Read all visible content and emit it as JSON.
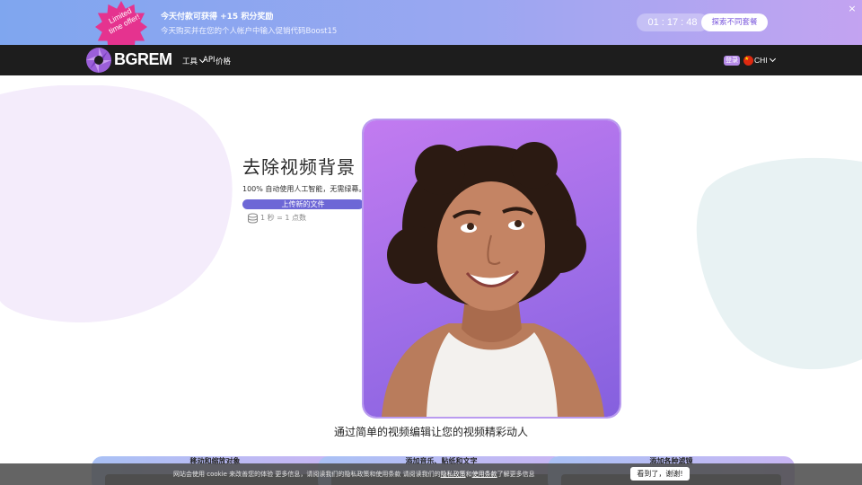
{
  "promo": {
    "badge_line1": "Limited",
    "badge_line2": "time offer!",
    "title": "今天付款可获得 +15 积分奖励",
    "subtitle": "今天购买并在您的个人帐户中输入促销代码Boost15",
    "timer": "01 : 17 : 48",
    "explore_label": "探索不同套餐",
    "close_icon": "×",
    "colors": {
      "gradient_start": "#7fa6ef",
      "gradient_end": "#c3a3f1",
      "badge": "#e5338f"
    }
  },
  "nav": {
    "logo_text": "BGREM",
    "tools_label": "工具",
    "api_label": "API",
    "pricing_label": "价格",
    "login_label": "登录",
    "language": "CHI",
    "icons": [
      "aperture-logo-icon",
      "chevron-down-icon",
      "china-flag-icon"
    ]
  },
  "hero": {
    "title": "去除视频背景",
    "subtitle": "100% 自动使用人工智能，无需绿幕。",
    "upload_label": "上传新的文件",
    "credits_text": "1 秒 = 1 点数"
  },
  "headline": "通过简单的视频编辑让您的视频精彩动人",
  "features": [
    {
      "title": "移动和缩放对象"
    },
    {
      "title": "添加音乐、贴纸和文字"
    },
    {
      "title": "添加各种滤镜"
    }
  ],
  "cookie": {
    "text_before": "网站会使用 cookie 来改善您的体验 更多信息，请阅读我们的隐私政策和使用条款 请阅读我们的",
    "privacy_link": "隐私政策",
    "and": "和",
    "terms_link": "使用条款",
    "text_after": "了解更多信息",
    "accept_label": "看到了，谢谢!"
  },
  "colors": {
    "nav_background": "#1d1d1d",
    "accent_purple": "#6d67d6",
    "photo_background": "#a06fe9"
  }
}
